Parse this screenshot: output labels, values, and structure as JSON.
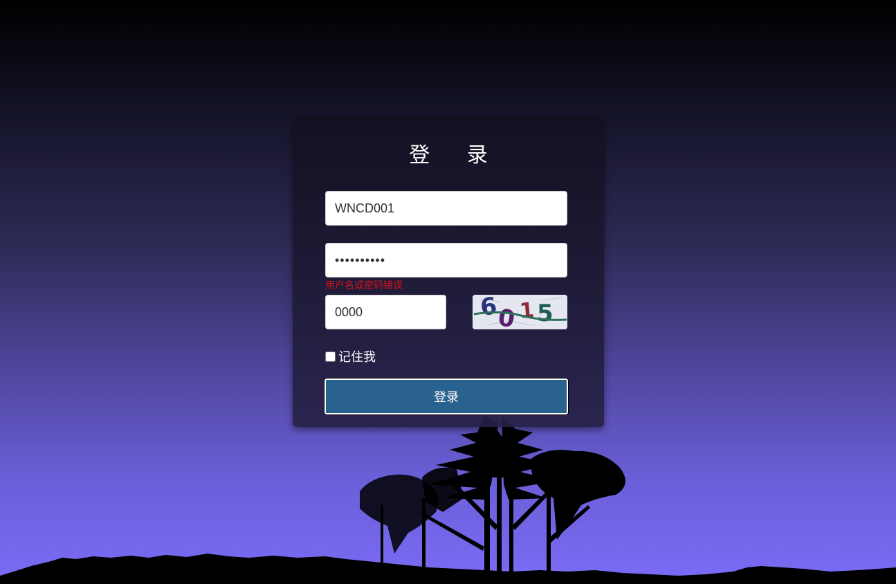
{
  "login": {
    "title": "登  录",
    "username_value": "WNCD001",
    "password_value": "••••••••••",
    "error_message": "用户名或密码错误",
    "captcha_value": "0000",
    "captcha_image_text": "6015",
    "remember_label": "记住我",
    "submit_label": "登录"
  },
  "colors": {
    "button": "#2a628f",
    "error": "#d3121a",
    "background_bottom": "#7a6cf6"
  }
}
